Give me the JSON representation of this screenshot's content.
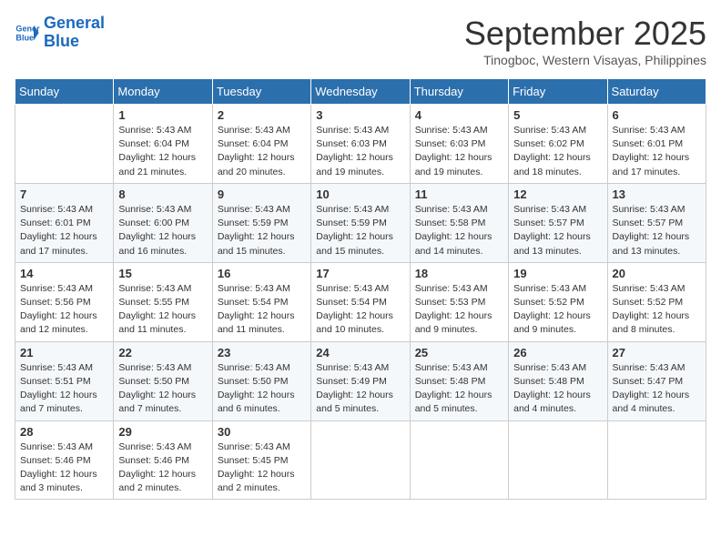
{
  "logo": {
    "line1": "General",
    "line2": "Blue"
  },
  "title": "September 2025",
  "subtitle": "Tinogboc, Western Visayas, Philippines",
  "header_days": [
    "Sunday",
    "Monday",
    "Tuesday",
    "Wednesday",
    "Thursday",
    "Friday",
    "Saturday"
  ],
  "weeks": [
    [
      {
        "day": "",
        "info": ""
      },
      {
        "day": "1",
        "info": "Sunrise: 5:43 AM\nSunset: 6:04 PM\nDaylight: 12 hours\nand 21 minutes."
      },
      {
        "day": "2",
        "info": "Sunrise: 5:43 AM\nSunset: 6:04 PM\nDaylight: 12 hours\nand 20 minutes."
      },
      {
        "day": "3",
        "info": "Sunrise: 5:43 AM\nSunset: 6:03 PM\nDaylight: 12 hours\nand 19 minutes."
      },
      {
        "day": "4",
        "info": "Sunrise: 5:43 AM\nSunset: 6:03 PM\nDaylight: 12 hours\nand 19 minutes."
      },
      {
        "day": "5",
        "info": "Sunrise: 5:43 AM\nSunset: 6:02 PM\nDaylight: 12 hours\nand 18 minutes."
      },
      {
        "day": "6",
        "info": "Sunrise: 5:43 AM\nSunset: 6:01 PM\nDaylight: 12 hours\nand 17 minutes."
      }
    ],
    [
      {
        "day": "7",
        "info": "Sunrise: 5:43 AM\nSunset: 6:01 PM\nDaylight: 12 hours\nand 17 minutes."
      },
      {
        "day": "8",
        "info": "Sunrise: 5:43 AM\nSunset: 6:00 PM\nDaylight: 12 hours\nand 16 minutes."
      },
      {
        "day": "9",
        "info": "Sunrise: 5:43 AM\nSunset: 5:59 PM\nDaylight: 12 hours\nand 15 minutes."
      },
      {
        "day": "10",
        "info": "Sunrise: 5:43 AM\nSunset: 5:59 PM\nDaylight: 12 hours\nand 15 minutes."
      },
      {
        "day": "11",
        "info": "Sunrise: 5:43 AM\nSunset: 5:58 PM\nDaylight: 12 hours\nand 14 minutes."
      },
      {
        "day": "12",
        "info": "Sunrise: 5:43 AM\nSunset: 5:57 PM\nDaylight: 12 hours\nand 13 minutes."
      },
      {
        "day": "13",
        "info": "Sunrise: 5:43 AM\nSunset: 5:57 PM\nDaylight: 12 hours\nand 13 minutes."
      }
    ],
    [
      {
        "day": "14",
        "info": "Sunrise: 5:43 AM\nSunset: 5:56 PM\nDaylight: 12 hours\nand 12 minutes."
      },
      {
        "day": "15",
        "info": "Sunrise: 5:43 AM\nSunset: 5:55 PM\nDaylight: 12 hours\nand 11 minutes."
      },
      {
        "day": "16",
        "info": "Sunrise: 5:43 AM\nSunset: 5:54 PM\nDaylight: 12 hours\nand 11 minutes."
      },
      {
        "day": "17",
        "info": "Sunrise: 5:43 AM\nSunset: 5:54 PM\nDaylight: 12 hours\nand 10 minutes."
      },
      {
        "day": "18",
        "info": "Sunrise: 5:43 AM\nSunset: 5:53 PM\nDaylight: 12 hours\nand 9 minutes."
      },
      {
        "day": "19",
        "info": "Sunrise: 5:43 AM\nSunset: 5:52 PM\nDaylight: 12 hours\nand 9 minutes."
      },
      {
        "day": "20",
        "info": "Sunrise: 5:43 AM\nSunset: 5:52 PM\nDaylight: 12 hours\nand 8 minutes."
      }
    ],
    [
      {
        "day": "21",
        "info": "Sunrise: 5:43 AM\nSunset: 5:51 PM\nDaylight: 12 hours\nand 7 minutes."
      },
      {
        "day": "22",
        "info": "Sunrise: 5:43 AM\nSunset: 5:50 PM\nDaylight: 12 hours\nand 7 minutes."
      },
      {
        "day": "23",
        "info": "Sunrise: 5:43 AM\nSunset: 5:50 PM\nDaylight: 12 hours\nand 6 minutes."
      },
      {
        "day": "24",
        "info": "Sunrise: 5:43 AM\nSunset: 5:49 PM\nDaylight: 12 hours\nand 5 minutes."
      },
      {
        "day": "25",
        "info": "Sunrise: 5:43 AM\nSunset: 5:48 PM\nDaylight: 12 hours\nand 5 minutes."
      },
      {
        "day": "26",
        "info": "Sunrise: 5:43 AM\nSunset: 5:48 PM\nDaylight: 12 hours\nand 4 minutes."
      },
      {
        "day": "27",
        "info": "Sunrise: 5:43 AM\nSunset: 5:47 PM\nDaylight: 12 hours\nand 4 minutes."
      }
    ],
    [
      {
        "day": "28",
        "info": "Sunrise: 5:43 AM\nSunset: 5:46 PM\nDaylight: 12 hours\nand 3 minutes."
      },
      {
        "day": "29",
        "info": "Sunrise: 5:43 AM\nSunset: 5:46 PM\nDaylight: 12 hours\nand 2 minutes."
      },
      {
        "day": "30",
        "info": "Sunrise: 5:43 AM\nSunset: 5:45 PM\nDaylight: 12 hours\nand 2 minutes."
      },
      {
        "day": "",
        "info": ""
      },
      {
        "day": "",
        "info": ""
      },
      {
        "day": "",
        "info": ""
      },
      {
        "day": "",
        "info": ""
      }
    ]
  ]
}
